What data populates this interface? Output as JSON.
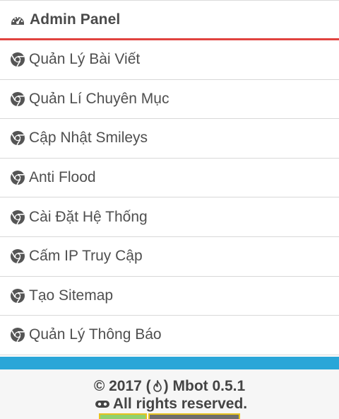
{
  "header": {
    "title": "Admin Panel",
    "icon": "dashboard-icon"
  },
  "menu": {
    "icon": "chrome-icon",
    "items": [
      {
        "label": "Quản Lý Bài Viết"
      },
      {
        "label": "Quản Lí Chuyên Mục"
      },
      {
        "label": "Cập Nhật Smileys"
      },
      {
        "label": "Anti Flood"
      },
      {
        "label": "Cài Đặt Hệ Thống"
      },
      {
        "label": "Cấm IP Truy Cập"
      },
      {
        "label": "Tạo Sitemap"
      },
      {
        "label": "Quản Lý Thông Báo"
      }
    ]
  },
  "footer": {
    "copyright_prefix": "© 2017 (",
    "copyright_suffix": ") Mbot 0.5.1",
    "rights": "All rights reserved.",
    "fire_icon": "fire-icon",
    "gamepad_icon": "gamepad-icon"
  },
  "colors": {
    "header_border": "#e0433f",
    "accent_bar": "#2aa6d8",
    "badge_green": "#8fd16f",
    "badge_border": "#e6c21f"
  }
}
